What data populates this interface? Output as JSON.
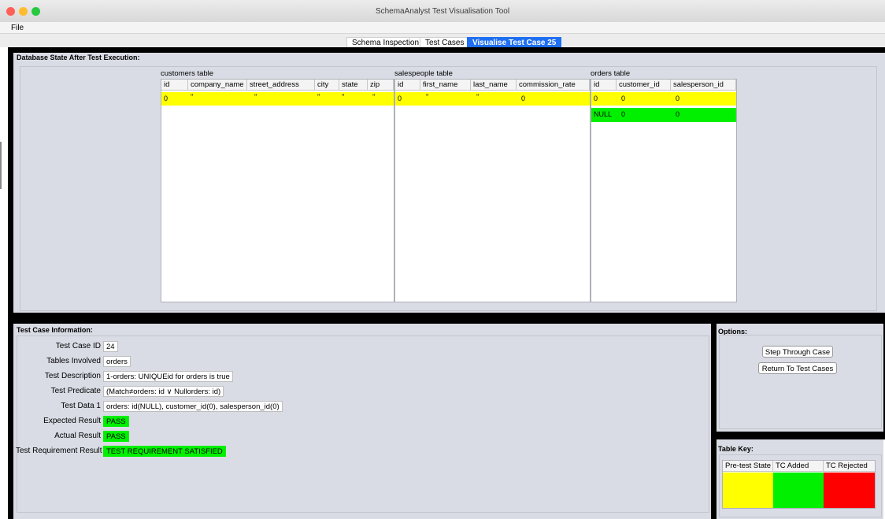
{
  "window": {
    "title": "SchemaAnalyst Test Visualisation Tool"
  },
  "menu": {
    "file": "File"
  },
  "tabs": [
    {
      "label": "Schema Inspection",
      "active": false
    },
    {
      "label": "Test Cases",
      "active": false
    },
    {
      "label": "Visualise Test Case 25",
      "active": true
    }
  ],
  "db_state": {
    "title": "Database State After Test Execution:",
    "customers": {
      "label": "customers table",
      "columns": [
        "id",
        "company_name",
        "street_address",
        "city",
        "state",
        "zip"
      ],
      "rows": [
        {
          "cells": [
            "0",
            "''",
            "''",
            "''",
            "''",
            "''"
          ],
          "state": "pre-test"
        }
      ]
    },
    "salespeople": {
      "label": "salespeople table",
      "columns": [
        "id",
        "first_name",
        "last_name",
        "commission_rate"
      ],
      "rows": [
        {
          "cells": [
            "0",
            "''",
            "''",
            "0"
          ],
          "state": "pre-test"
        }
      ]
    },
    "orders": {
      "label": "orders table",
      "columns": [
        "id",
        "customer_id",
        "salesperson_id"
      ],
      "rows": [
        {
          "cells": [
            "0",
            "0",
            "0"
          ],
          "state": "pre-test"
        },
        {
          "cells": [
            "NULL",
            "0",
            "0"
          ],
          "state": "added"
        }
      ]
    }
  },
  "info": {
    "title": "Test Case Information:",
    "test_case_id_label": "Test Case ID",
    "test_case_id": "24",
    "tables_label": "Tables Involved",
    "tables": "orders",
    "description_label": "Test Description",
    "description": "1-orders: UNIQUEid for orders is true",
    "predicate_label": "Test Predicate",
    "predicate": "(Match≠orders: id ∨ Nullorders: id)",
    "data_label": "Test Data 1",
    "data": "orders: id(NULL), customer_id(0), salesperson_id(0)",
    "expected_label": "Expected Result",
    "expected": "PASS",
    "actual_label": "Actual Result",
    "actual": "PASS",
    "requirement_label": "Test Requirement Result",
    "requirement": "TEST REQUIREMENT SATISFIED"
  },
  "options": {
    "title": "Options:",
    "step_button": "Step Through Case",
    "return_button": "Return To Test Cases"
  },
  "key": {
    "title": "Table Key:",
    "columns": [
      "Pre-test State",
      "TC Added",
      "TC Rejected"
    ],
    "colors": [
      "#ffff00",
      "#00f000",
      "#ff0000"
    ]
  }
}
